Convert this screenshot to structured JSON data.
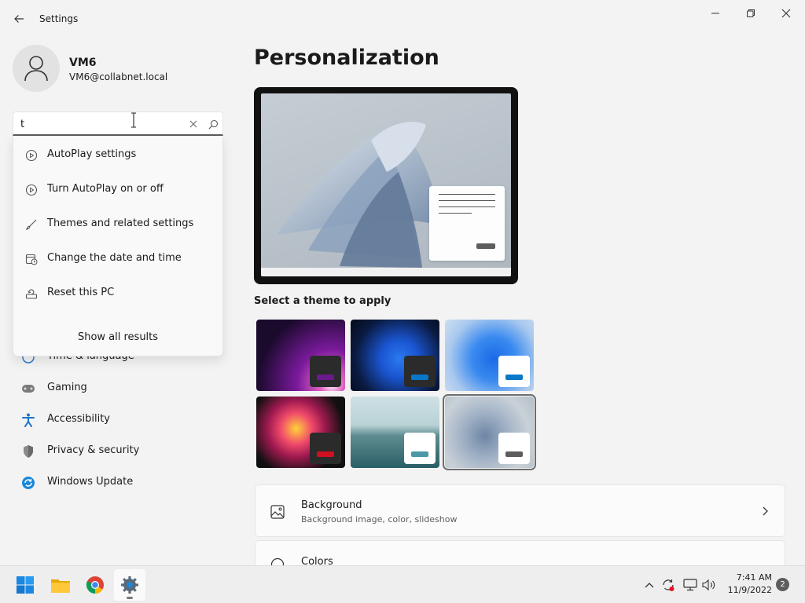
{
  "window": {
    "title": "Settings"
  },
  "profile": {
    "name": "VM6",
    "email": "VM6@collabnet.local"
  },
  "search": {
    "value": "t",
    "suggestions": [
      {
        "label": "AutoPlay settings",
        "icon": "autoplay-icon"
      },
      {
        "label": "Turn AutoPlay on or off",
        "icon": "autoplay-icon"
      },
      {
        "label": "Themes and related settings",
        "icon": "brush-icon"
      },
      {
        "label": "Change the date and time",
        "icon": "calendar-clock-icon"
      },
      {
        "label": "Reset this PC",
        "icon": "reset-pc-icon"
      }
    ],
    "show_all_label": "Show all results"
  },
  "sidebar": {
    "items": [
      {
        "label": "Time & language",
        "icon": "globe-clock-icon"
      },
      {
        "label": "Gaming",
        "icon": "gamepad-icon"
      },
      {
        "label": "Accessibility",
        "icon": "accessibility-icon"
      },
      {
        "label": "Privacy & security",
        "icon": "shield-icon"
      },
      {
        "label": "Windows Update",
        "icon": "update-icon"
      }
    ]
  },
  "main": {
    "title": "Personalization",
    "themes_label": "Select a theme to apply",
    "themes": [
      {
        "name": "glow",
        "chip_color": "#6a1a8c"
      },
      {
        "name": "windows-dark",
        "chip_color": "#0a78c8"
      },
      {
        "name": "windows-light",
        "chip_color": "#0a78c8"
      },
      {
        "name": "captured-motion",
        "chip_color": "#d01020"
      },
      {
        "name": "sunrise-lake",
        "chip_color": "#4a98a8"
      },
      {
        "name": "flow",
        "chip_color": "#5d5d5d",
        "selected": true
      }
    ],
    "cards": [
      {
        "title": "Background",
        "subtitle": "Background image, color, slideshow"
      },
      {
        "title": "Colors",
        "subtitle": ""
      }
    ]
  },
  "taskbar": {
    "apps": [
      "start-icon",
      "file-explorer-icon",
      "chrome-icon",
      "settings-icon"
    ],
    "time": "7:41 AM",
    "date": "11/9/2022",
    "notifications": "2"
  }
}
